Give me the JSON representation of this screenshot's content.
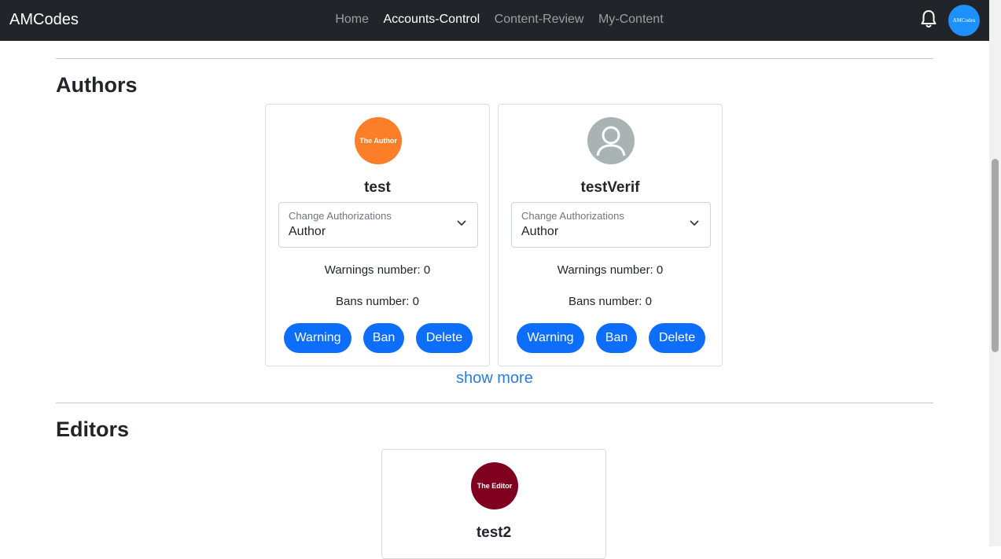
{
  "navbar": {
    "brand": "AMCodes",
    "links": [
      "Home",
      "Accounts-Control",
      "Content-Review",
      "My-Content"
    ],
    "active_link": "Accounts-Control",
    "notification_icon": "bell-icon",
    "avatar_text": "AMCodes"
  },
  "sections": {
    "authors": {
      "title": "Authors",
      "show_more": "show more",
      "cards": [
        {
          "avatar_text": "The Author",
          "avatar_color": "#fd7e29",
          "name": "test",
          "select_label": "Change Authorizations",
          "select_value": "Author",
          "warnings": "Warnings number: 0",
          "bans": "Bans number: 0",
          "buttons": [
            "Warning",
            "Ban",
            "Delete"
          ]
        },
        {
          "avatar_text": "",
          "avatar_color": "#a9b3b3",
          "avatar_icon": "default-user-icon",
          "name": "testVerif",
          "select_label": "Change Authorizations",
          "select_value": "Author",
          "warnings": "Warnings number: 0",
          "bans": "Bans number: 0",
          "buttons": [
            "Warning",
            "Ban",
            "Delete"
          ]
        }
      ]
    },
    "editors": {
      "title": "Editors",
      "cards": [
        {
          "avatar_text": "The Editor",
          "avatar_color": "#800020",
          "name": "test2"
        }
      ]
    }
  },
  "colors": {
    "navbar_bg": "#212529",
    "primary_button": "#0d6efd",
    "link": "#2b7be4"
  }
}
